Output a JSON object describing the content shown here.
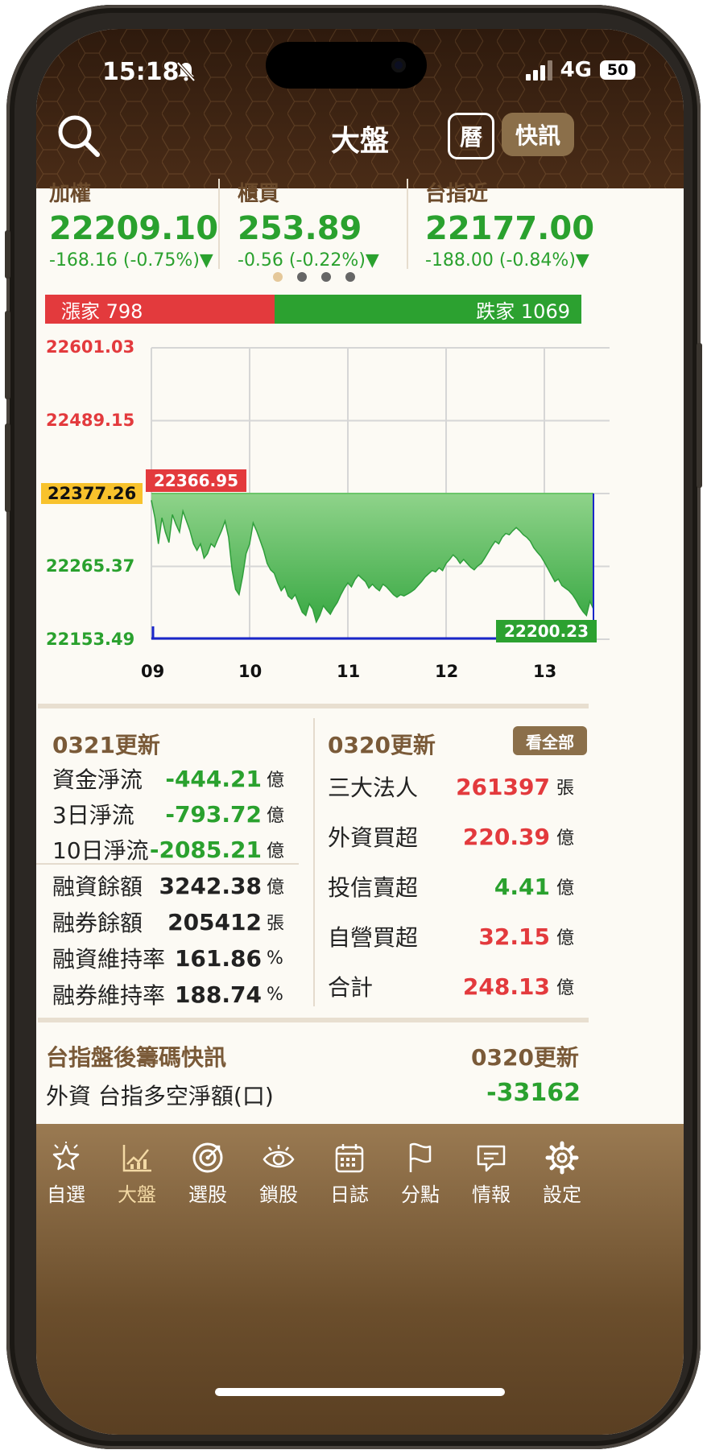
{
  "status": {
    "time": "15:18",
    "network": "4G",
    "battery": "50"
  },
  "header": {
    "title": "大盤",
    "calendar_label": "曆",
    "news_label": "快訊"
  },
  "indices": [
    {
      "name": "加權",
      "price": "22209.10",
      "change": "-168.16 (-0.75%)▼"
    },
    {
      "name": "櫃買",
      "price": "253.89",
      "change": "-0.56 (-0.22%)▼"
    },
    {
      "name": "台指近",
      "price": "22177.00",
      "change": "-188.00 (-0.84%)▼"
    }
  ],
  "advance_decline": {
    "up_label": "漲家 798",
    "down_label": "跌家 1069",
    "up": 798,
    "down": 1069
  },
  "chart_data": {
    "type": "area",
    "y_ticks": [
      "22601.03",
      "22489.15",
      "22377.26",
      "22265.37",
      "22153.49"
    ],
    "ylim": [
      22153.49,
      22601.03
    ],
    "reference": 22377.26,
    "open_label": "22366.95",
    "last_label": "22200.23",
    "x_ticks": [
      "09",
      "10",
      "11",
      "12",
      "13"
    ],
    "grid": true,
    "series": [
      {
        "values": [
          22366.95,
          22340,
          22300,
          22340,
          22318,
          22302,
          22345,
          22330,
          22318,
          22350,
          22335,
          22320,
          22300,
          22290,
          22300,
          22278,
          22285,
          22300,
          22295,
          22308,
          22320,
          22335,
          22310,
          22260,
          22230,
          22222,
          22250,
          22285,
          22300,
          22332,
          22320,
          22305,
          22290,
          22270,
          22260,
          22255,
          22240,
          22228,
          22235,
          22220,
          22215,
          22222,
          22208,
          22195,
          22190,
          22208,
          22200,
          22180,
          22190,
          22205,
          22198,
          22192,
          22202,
          22210,
          22222,
          22232,
          22240,
          22234,
          22245,
          22252,
          22247,
          22242,
          22232,
          22238,
          22232,
          22228,
          22238,
          22234,
          22228,
          22222,
          22218,
          22222,
          22220,
          22223,
          22226,
          22230,
          22236,
          22242,
          22249,
          22254,
          22259,
          22257,
          22263,
          22259,
          22270,
          22276,
          22283,
          22278,
          22270,
          22276,
          22270,
          22264,
          22260,
          22266,
          22270,
          22278,
          22287,
          22296,
          22304,
          22300,
          22310,
          22316,
          22314,
          22320,
          22325,
          22320,
          22314,
          22310,
          22304,
          22294,
          22287,
          22281,
          22272,
          22262,
          22252,
          22242,
          22246,
          22236,
          22232,
          22228,
          22222,
          22214,
          22204,
          22196,
          22190,
          22212,
          22200
        ]
      }
    ]
  },
  "funds": {
    "title": "0321更新",
    "rows": [
      {
        "label": "資金淨流",
        "value": "-444.21",
        "unit": "億"
      },
      {
        "label": "3日淨流",
        "value": "-793.72",
        "unit": "億"
      },
      {
        "label": "10日淨流",
        "value": "-2085.21",
        "unit": "億"
      }
    ],
    "margin_rows": [
      {
        "label": "融資餘額",
        "value": "3242.38",
        "unit": "億"
      },
      {
        "label": "融券餘額",
        "value": "205412",
        "unit": "張"
      },
      {
        "label": "融資維持率",
        "value": "161.86",
        "unit": "%"
      },
      {
        "label": "融券維持率",
        "value": "188.74",
        "unit": "%"
      }
    ]
  },
  "institutional": {
    "title": "0320更新",
    "view_all": "看全部",
    "rows": [
      {
        "label": "三大法人",
        "value": "261397",
        "unit": "張"
      },
      {
        "label": "外資買超",
        "value": "220.39",
        "unit": "億"
      },
      {
        "label": "投信賣超",
        "value": "4.41",
        "unit": "億"
      },
      {
        "label": "自營買超",
        "value": "32.15",
        "unit": "億"
      },
      {
        "label": "合計",
        "value": "248.13",
        "unit": "億"
      }
    ]
  },
  "futures": {
    "title": "台指盤後籌碼快訊",
    "updated": "0320更新",
    "row_label": "外資 台指多空淨額(口)",
    "row_value": "-33162"
  },
  "tabs": [
    {
      "label": "自選",
      "icon": "star-icon"
    },
    {
      "label": "大盤",
      "icon": "chart-icon"
    },
    {
      "label": "選股",
      "icon": "target-icon"
    },
    {
      "label": "鎖股",
      "icon": "eye-icon"
    },
    {
      "label": "日誌",
      "icon": "calendar-icon"
    },
    {
      "label": "分點",
      "icon": "flag-icon"
    },
    {
      "label": "情報",
      "icon": "message-icon"
    },
    {
      "label": "設定",
      "icon": "gear-icon"
    }
  ],
  "colors": {
    "up": "#e33a3d",
    "down": "#2aa12e",
    "accent": "#8b6f4a",
    "reference": "#f8c22c"
  }
}
